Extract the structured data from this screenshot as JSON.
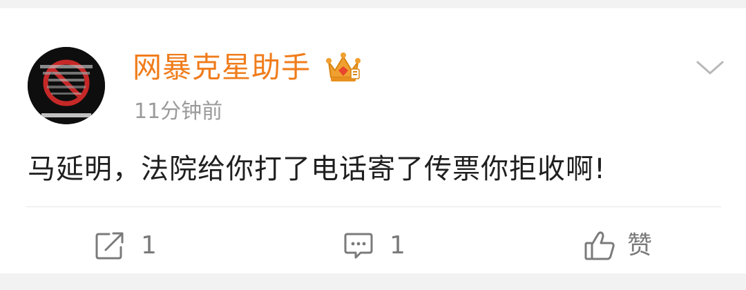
{
  "post": {
    "author": {
      "name": "网暴克星助手",
      "avatar_icon": "avatar-image",
      "badge_icon": "crown-vip-icon"
    },
    "timestamp": "11分钟前",
    "content": "马延明，法院给你打了电话寄了传票你拒收啊!",
    "menu_icon": "chevron-down-icon"
  },
  "actions": {
    "repost": {
      "icon": "share-icon",
      "count": "1"
    },
    "comment": {
      "icon": "comment-icon",
      "count": "1"
    },
    "like": {
      "icon": "thumbs-up-icon",
      "label": "赞"
    }
  },
  "colors": {
    "username": "#f07c1b",
    "timestamp": "#9a9a9a",
    "content": "#1f1f1f",
    "action": "#7a7a7a",
    "crown": "#f0a030",
    "crown_gem": "#e8452c"
  }
}
